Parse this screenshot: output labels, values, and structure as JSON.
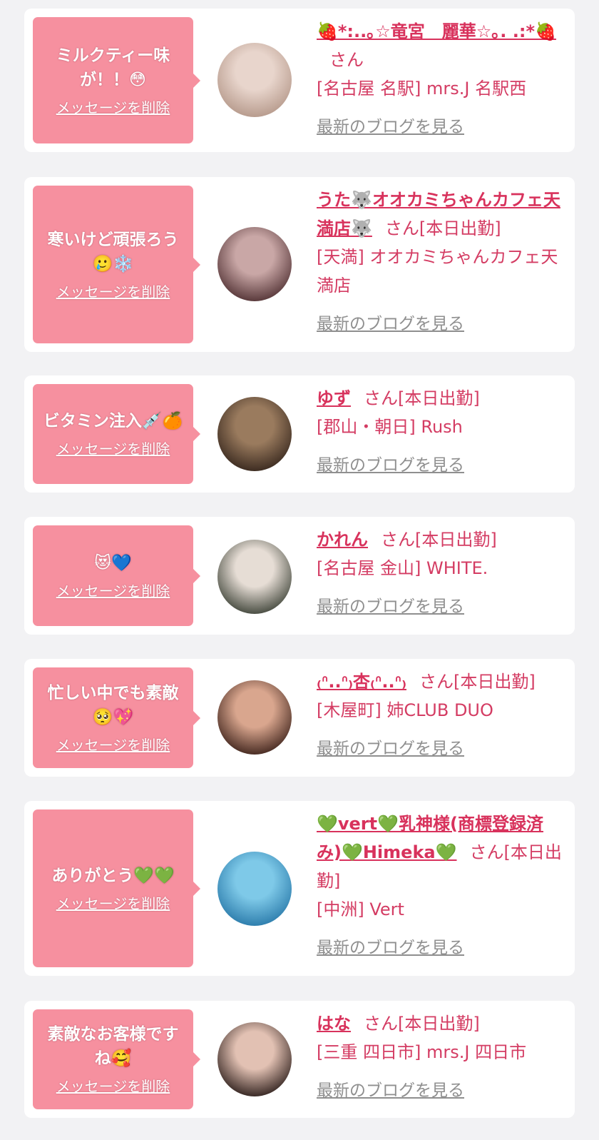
{
  "items": [
    {
      "message": "ミルクティー味が！！😳",
      "delete_label": "メッセージを削除",
      "name": "🍓*:..｡☆竜宮　麗華☆｡. .:*🍓",
      "suffix": "さん",
      "shop": "[名古屋 名駅] mrs.J 名駅西",
      "blog_label": "最新のブログを見る",
      "avatar_colors": [
        "#e8d5cc",
        "#b89c8e"
      ]
    },
    {
      "message": "寒いけど頑張ろう🥲❄️",
      "delete_label": "メッセージを削除",
      "name": "うた🐺オオカミちゃんカフェ天満店🐺",
      "suffix": "さん[本日出勤]",
      "shop": "[天満] オオカミちゃんカフェ天満店",
      "blog_label": "最新のブログを見る",
      "avatar_colors": [
        "#c9a7a6",
        "#5a3a3c"
      ]
    },
    {
      "message": "ビタミン注入💉🍊",
      "delete_label": "メッセージを削除",
      "name": "ゆず",
      "suffix": "さん[本日出勤]",
      "shop": "[郡山・朝日] Rush",
      "blog_label": "最新のブログを見る",
      "avatar_colors": [
        "#9a7b5e",
        "#3e2d22"
      ]
    },
    {
      "message": "😻💙",
      "delete_label": "メッセージを削除",
      "name": "かれん",
      "suffix": "さん[本日出勤]",
      "shop": "[名古屋 金山] WHITE.",
      "blog_label": "最新のブログを見る",
      "avatar_colors": [
        "#e6ddd5",
        "#4b4f44"
      ]
    },
    {
      "message": "忙しい中でも素敵🥺💖",
      "delete_label": "メッセージを削除",
      "name": "₍ᐢ..ᐢ₎杏₍ᐢ..ᐢ₎",
      "suffix": "さん[本日出勤]",
      "shop": "[木屋町] 姉CLUB DUO",
      "blog_label": "最新のブログを見る",
      "avatar_colors": [
        "#d9a68e",
        "#4a2d24"
      ]
    },
    {
      "message": "ありがとう💚💚",
      "delete_label": "メッセージを削除",
      "name": "💚vert💚乳神様(商標登録済み)💚Himeka💚",
      "suffix": "さん[本日出勤]",
      "shop": "[中洲] Vert",
      "blog_label": "最新のブログを見る",
      "avatar_colors": [
        "#7ec9e8",
        "#2f7fae"
      ]
    },
    {
      "message": "素敵なお客様ですね🥰",
      "delete_label": "メッセージを削除",
      "name": "はな",
      "suffix": "さん[本日出勤]",
      "shop": "[三重 四日市] mrs.J 四日市",
      "blog_label": "最新のブログを見る",
      "avatar_colors": [
        "#e2c1b3",
        "#3a2a26"
      ]
    }
  ]
}
